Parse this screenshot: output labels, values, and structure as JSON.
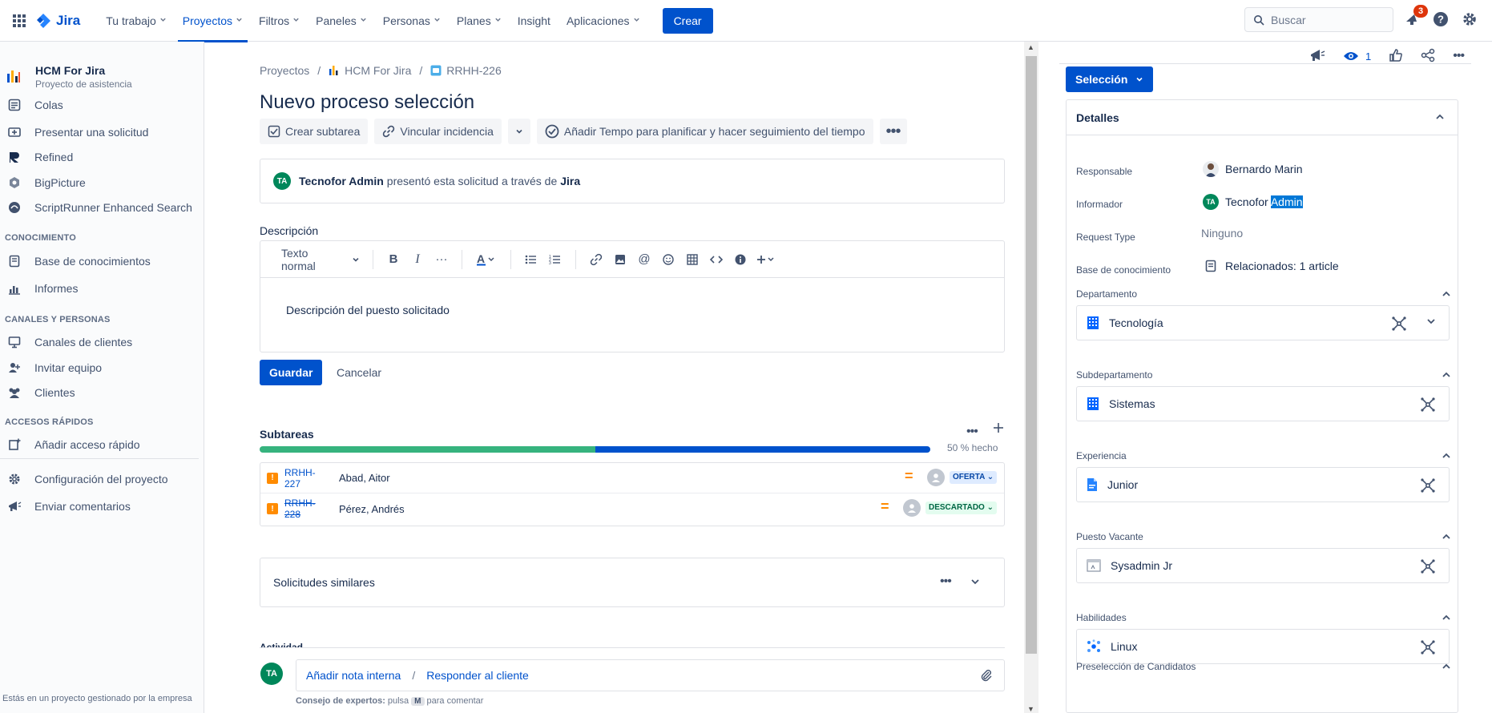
{
  "topnav": {
    "logo_text": "Jira",
    "items": [
      {
        "label": "Tu trabajo",
        "chevron": true
      },
      {
        "label": "Proyectos",
        "chevron": true,
        "active": true
      },
      {
        "label": "Filtros",
        "chevron": true
      },
      {
        "label": "Paneles",
        "chevron": true
      },
      {
        "label": "Personas",
        "chevron": true
      },
      {
        "label": "Planes",
        "chevron": true
      },
      {
        "label": "Insight",
        "chevron": false
      },
      {
        "label": "Aplicaciones",
        "chevron": true
      }
    ],
    "create_label": "Crear",
    "search_placeholder": "Buscar",
    "notification_count": "3",
    "accent": "#0052CC"
  },
  "sidebar": {
    "project_name": "HCM For Jira",
    "project_type": "Proyecto de asistencia",
    "items": [
      {
        "label": "Colas",
        "icon": "queue-icon"
      },
      {
        "label": "Presentar una solicitud",
        "icon": "raise-request-icon"
      },
      {
        "label": "Refined",
        "icon": "refined-icon"
      },
      {
        "label": "BigPicture",
        "icon": "bigpicture-icon"
      },
      {
        "label": "ScriptRunner Enhanced Search",
        "icon": "scriptrunner-icon"
      }
    ],
    "section_knowledge": "CONOCIMIENTO",
    "knowledge_items": [
      {
        "label": "Base de conocimientos",
        "icon": "knowledge-base-icon"
      },
      {
        "label": "Informes",
        "icon": "reports-icon"
      }
    ],
    "section_channels": "CANALES Y PERSONAS",
    "channel_items": [
      {
        "label": "Canales de clientes",
        "icon": "monitor-icon"
      },
      {
        "label": "Invitar equipo",
        "icon": "invite-icon"
      },
      {
        "label": "Clientes",
        "icon": "people-icon"
      }
    ],
    "section_shortcuts": "ACCESOS RÁPIDOS",
    "shortcut_items": [
      {
        "label": "Añadir acceso rápido",
        "icon": "add-shortcut-icon"
      }
    ],
    "bottom_items": [
      {
        "label": "Configuración del proyecto",
        "icon": "gear-icon"
      },
      {
        "label": "Enviar comentarios",
        "icon": "megaphone-icon"
      }
    ],
    "footer": "Estás en un proyecto gestionado por la empresa"
  },
  "issue": {
    "breadcrumb": [
      "Proyectos",
      "HCM For Jira",
      "RRHH-226"
    ],
    "title": "Nuevo proceso selección",
    "toolbar": {
      "create_subtask": "Crear subtarea",
      "link_issue": "Vincular incidencia",
      "tempo": "Añadir Tempo para planificar y hacer seguimiento del tiempo"
    },
    "reporter_initials": "TA",
    "reporter_name": "Tecnofor Admin",
    "reporter_text": "presentó esta solicitud a través de",
    "reporter_channel": "Jira",
    "description_label": "Descripción",
    "editor_style": "Texto normal",
    "description_text": "Descripción del puesto solicitado",
    "save_label": "Guardar",
    "cancel_label": "Cancelar",
    "subtasks_title": "Subtareas",
    "subtasks_progress": 0.5,
    "subtasks_progress_text": "50 % hecho",
    "subtasks": [
      {
        "key": "RRHH-227",
        "summary": "Abad, Aitor",
        "status": "OFERTA",
        "done": false,
        "status_bg": "#DEEBFF",
        "status_fg": "#0747A6"
      },
      {
        "key": "RRHH-228",
        "summary": "Pérez, Andrés",
        "status": "DESCARTADO",
        "done": true,
        "status_bg": "#E3FCEF",
        "status_fg": "#006644"
      }
    ],
    "similar_title": "Solicitudes similares",
    "activity_label": "Actividad",
    "comment_initials": "TA",
    "comment_internal": "Añadir nota interna",
    "comment_sep": "/",
    "comment_reply": "Responder al cliente",
    "tip_label": "Consejo de expertos:",
    "tip_press": "pulsa",
    "tip_key": "M",
    "tip_suffix": "para comentar"
  },
  "panel": {
    "watchers": "1",
    "status_label": "Selección",
    "details_title": "Detalles",
    "fields": [
      {
        "label": "Responsable",
        "value": "Bernardo Marin"
      },
      {
        "label": "Informador",
        "value_main": "Tecnofor",
        "value_selected": "Admin",
        "initials": "TA"
      },
      {
        "label": "Request Type",
        "value": "Ninguno"
      },
      {
        "label": "Base de conocimiento",
        "value": "Relacionados: 1 article"
      }
    ],
    "sections": [
      {
        "label": "Departamento",
        "value": "Tecnología",
        "icon": "building-icon",
        "has_dropdown": true
      },
      {
        "label": "Subdepartamento",
        "value": "Sistemas",
        "icon": "building-icon",
        "has_dropdown": false
      },
      {
        "label": "Experiencia",
        "value": "Junior",
        "icon": "document-icon",
        "has_dropdown": false
      },
      {
        "label": "Puesto Vacante",
        "value": "Sysadmin Jr",
        "icon": "window-icon",
        "has_dropdown": false
      },
      {
        "label": "Habilidades",
        "value": "Linux",
        "icon": "network-icon",
        "has_dropdown": false
      }
    ],
    "last_section_label": "Preselección de Candidatos"
  }
}
